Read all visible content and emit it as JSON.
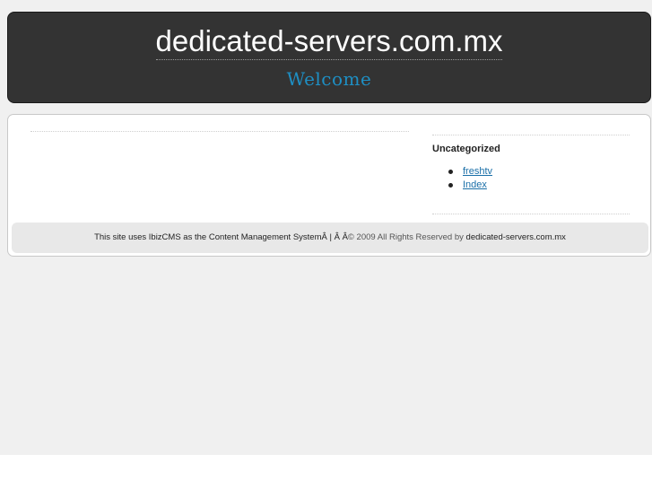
{
  "header": {
    "site_title": "dedicated-servers.com.mx",
    "tagline": "Welcome"
  },
  "sidebar": {
    "heading": "Uncategorized",
    "items": [
      {
        "label": "freshtv"
      },
      {
        "label": "Index"
      }
    ]
  },
  "footer": {
    "cms_text": "This site uses IbizCMS as the Content Management SystemÂ  | Â  Â",
    "rights_text": "© 2009 All Rights Reserved by",
    "site_name": "dedicated-servers.com.mx"
  },
  "colors": {
    "header_bg": "#333333",
    "tagline": "#1e8fc4",
    "link": "#1a6fa8",
    "page_bg": "#f0f0f0"
  }
}
